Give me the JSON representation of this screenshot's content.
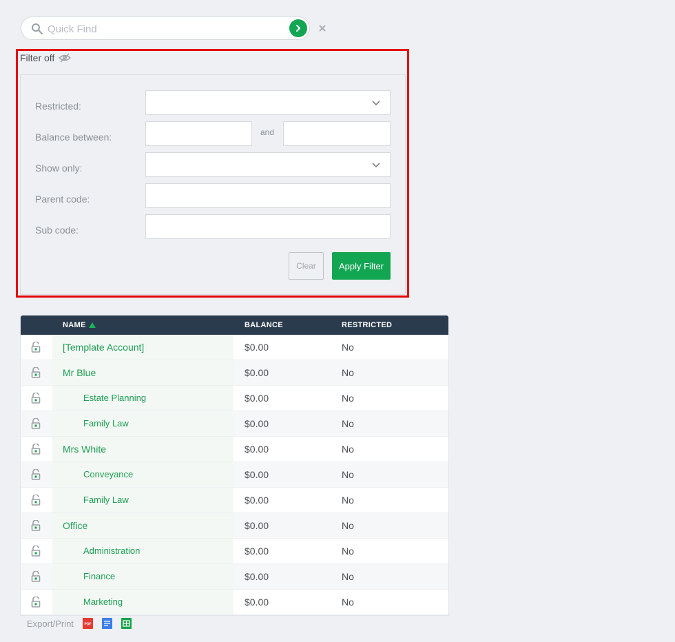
{
  "quickfind": {
    "placeholder": "Quick Find"
  },
  "filter": {
    "toggle_label": "Filter off",
    "fields": {
      "restricted_label": "Restricted:",
      "balance_label": "Balance between:",
      "and_label": "and",
      "showonly_label": "Show only:",
      "parent_label": "Parent code:",
      "sub_label": "Sub code:"
    },
    "clear_label": "Clear",
    "apply_label": "Apply Filter"
  },
  "table": {
    "columns": {
      "name": "NAME",
      "balance": "BALANCE",
      "restricted": "RESTRICTED"
    },
    "rows": [
      {
        "name": "[Template Account]",
        "balance": "$0.00",
        "restricted": "No",
        "level": 0
      },
      {
        "name": "Mr Blue",
        "balance": "$0.00",
        "restricted": "No",
        "level": 0
      },
      {
        "name": "Estate Planning",
        "balance": "$0.00",
        "restricted": "No",
        "level": 1
      },
      {
        "name": "Family Law",
        "balance": "$0.00",
        "restricted": "No",
        "level": 1
      },
      {
        "name": "Mrs White",
        "balance": "$0.00",
        "restricted": "No",
        "level": 0
      },
      {
        "name": "Conveyance",
        "balance": "$0.00",
        "restricted": "No",
        "level": 1
      },
      {
        "name": "Family Law",
        "balance": "$0.00",
        "restricted": "No",
        "level": 1
      },
      {
        "name": "Office",
        "balance": "$0.00",
        "restricted": "No",
        "level": 0
      },
      {
        "name": "Administration",
        "balance": "$0.00",
        "restricted": "No",
        "level": 1
      },
      {
        "name": "Finance",
        "balance": "$0.00",
        "restricted": "No",
        "level": 1
      },
      {
        "name": "Marketing",
        "balance": "$0.00",
        "restricted": "No",
        "level": 1
      }
    ]
  },
  "export": {
    "label": "Export/Print",
    "pdf_label": "PDF"
  },
  "colors": {
    "accent": "#12a653",
    "header": "#2b3b4e",
    "highlight": "#e60000",
    "link": "#1e9e52"
  }
}
